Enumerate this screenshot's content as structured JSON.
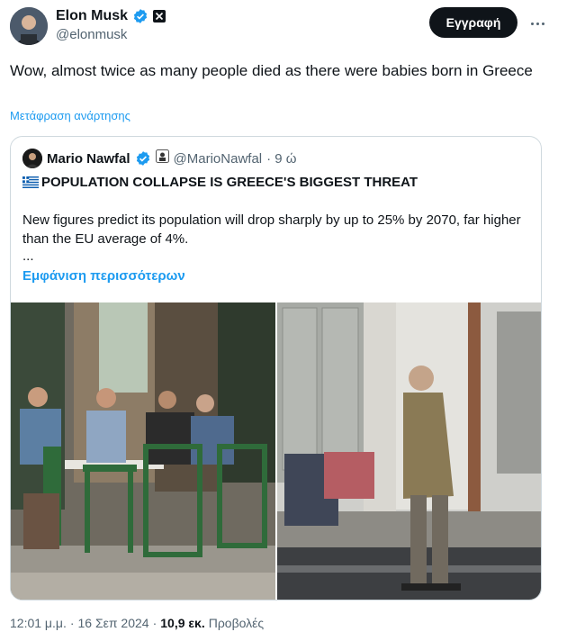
{
  "tweet": {
    "author_name": "Elon Musk",
    "handle": "@elonmusk",
    "follow_label": "Εγγραφή",
    "text": "Wow, almost twice as many people died as there were babies born in Greece",
    "translate_label": "Μετάφραση ανάρτησης"
  },
  "quote": {
    "author_name": "Mario Nawfal",
    "handle": "@MarioNawfal",
    "time": "· 9 ώ",
    "title": "POPULATION COLLAPSE IS GREECE'S BIGGEST THREAT",
    "body": "New figures predict its population will drop sharply by up to 25% by 2070, far higher than the EU average of 4%.",
    "ellipsis": "...",
    "show_more_label": "Εμφάνιση περισσότερων"
  },
  "meta": {
    "time": "12:01 μ.μ.",
    "separator": "·",
    "date": "16 Σεπ 2024",
    "separator2": "·",
    "views_count": "10,9 εκ.",
    "views_label": "Προβολές"
  },
  "icons": {
    "verified": "verified-badge-icon",
    "x_affiliate": "x-logo-icon",
    "more": "more-options-icon",
    "flag": "greece-flag-icon"
  },
  "colors": {
    "accent": "#1d9bf0",
    "text": "#0f1419",
    "secondary": "#536471",
    "button": "#0f1419",
    "verified": "#1d9bf0",
    "border": "#cfd9de"
  }
}
